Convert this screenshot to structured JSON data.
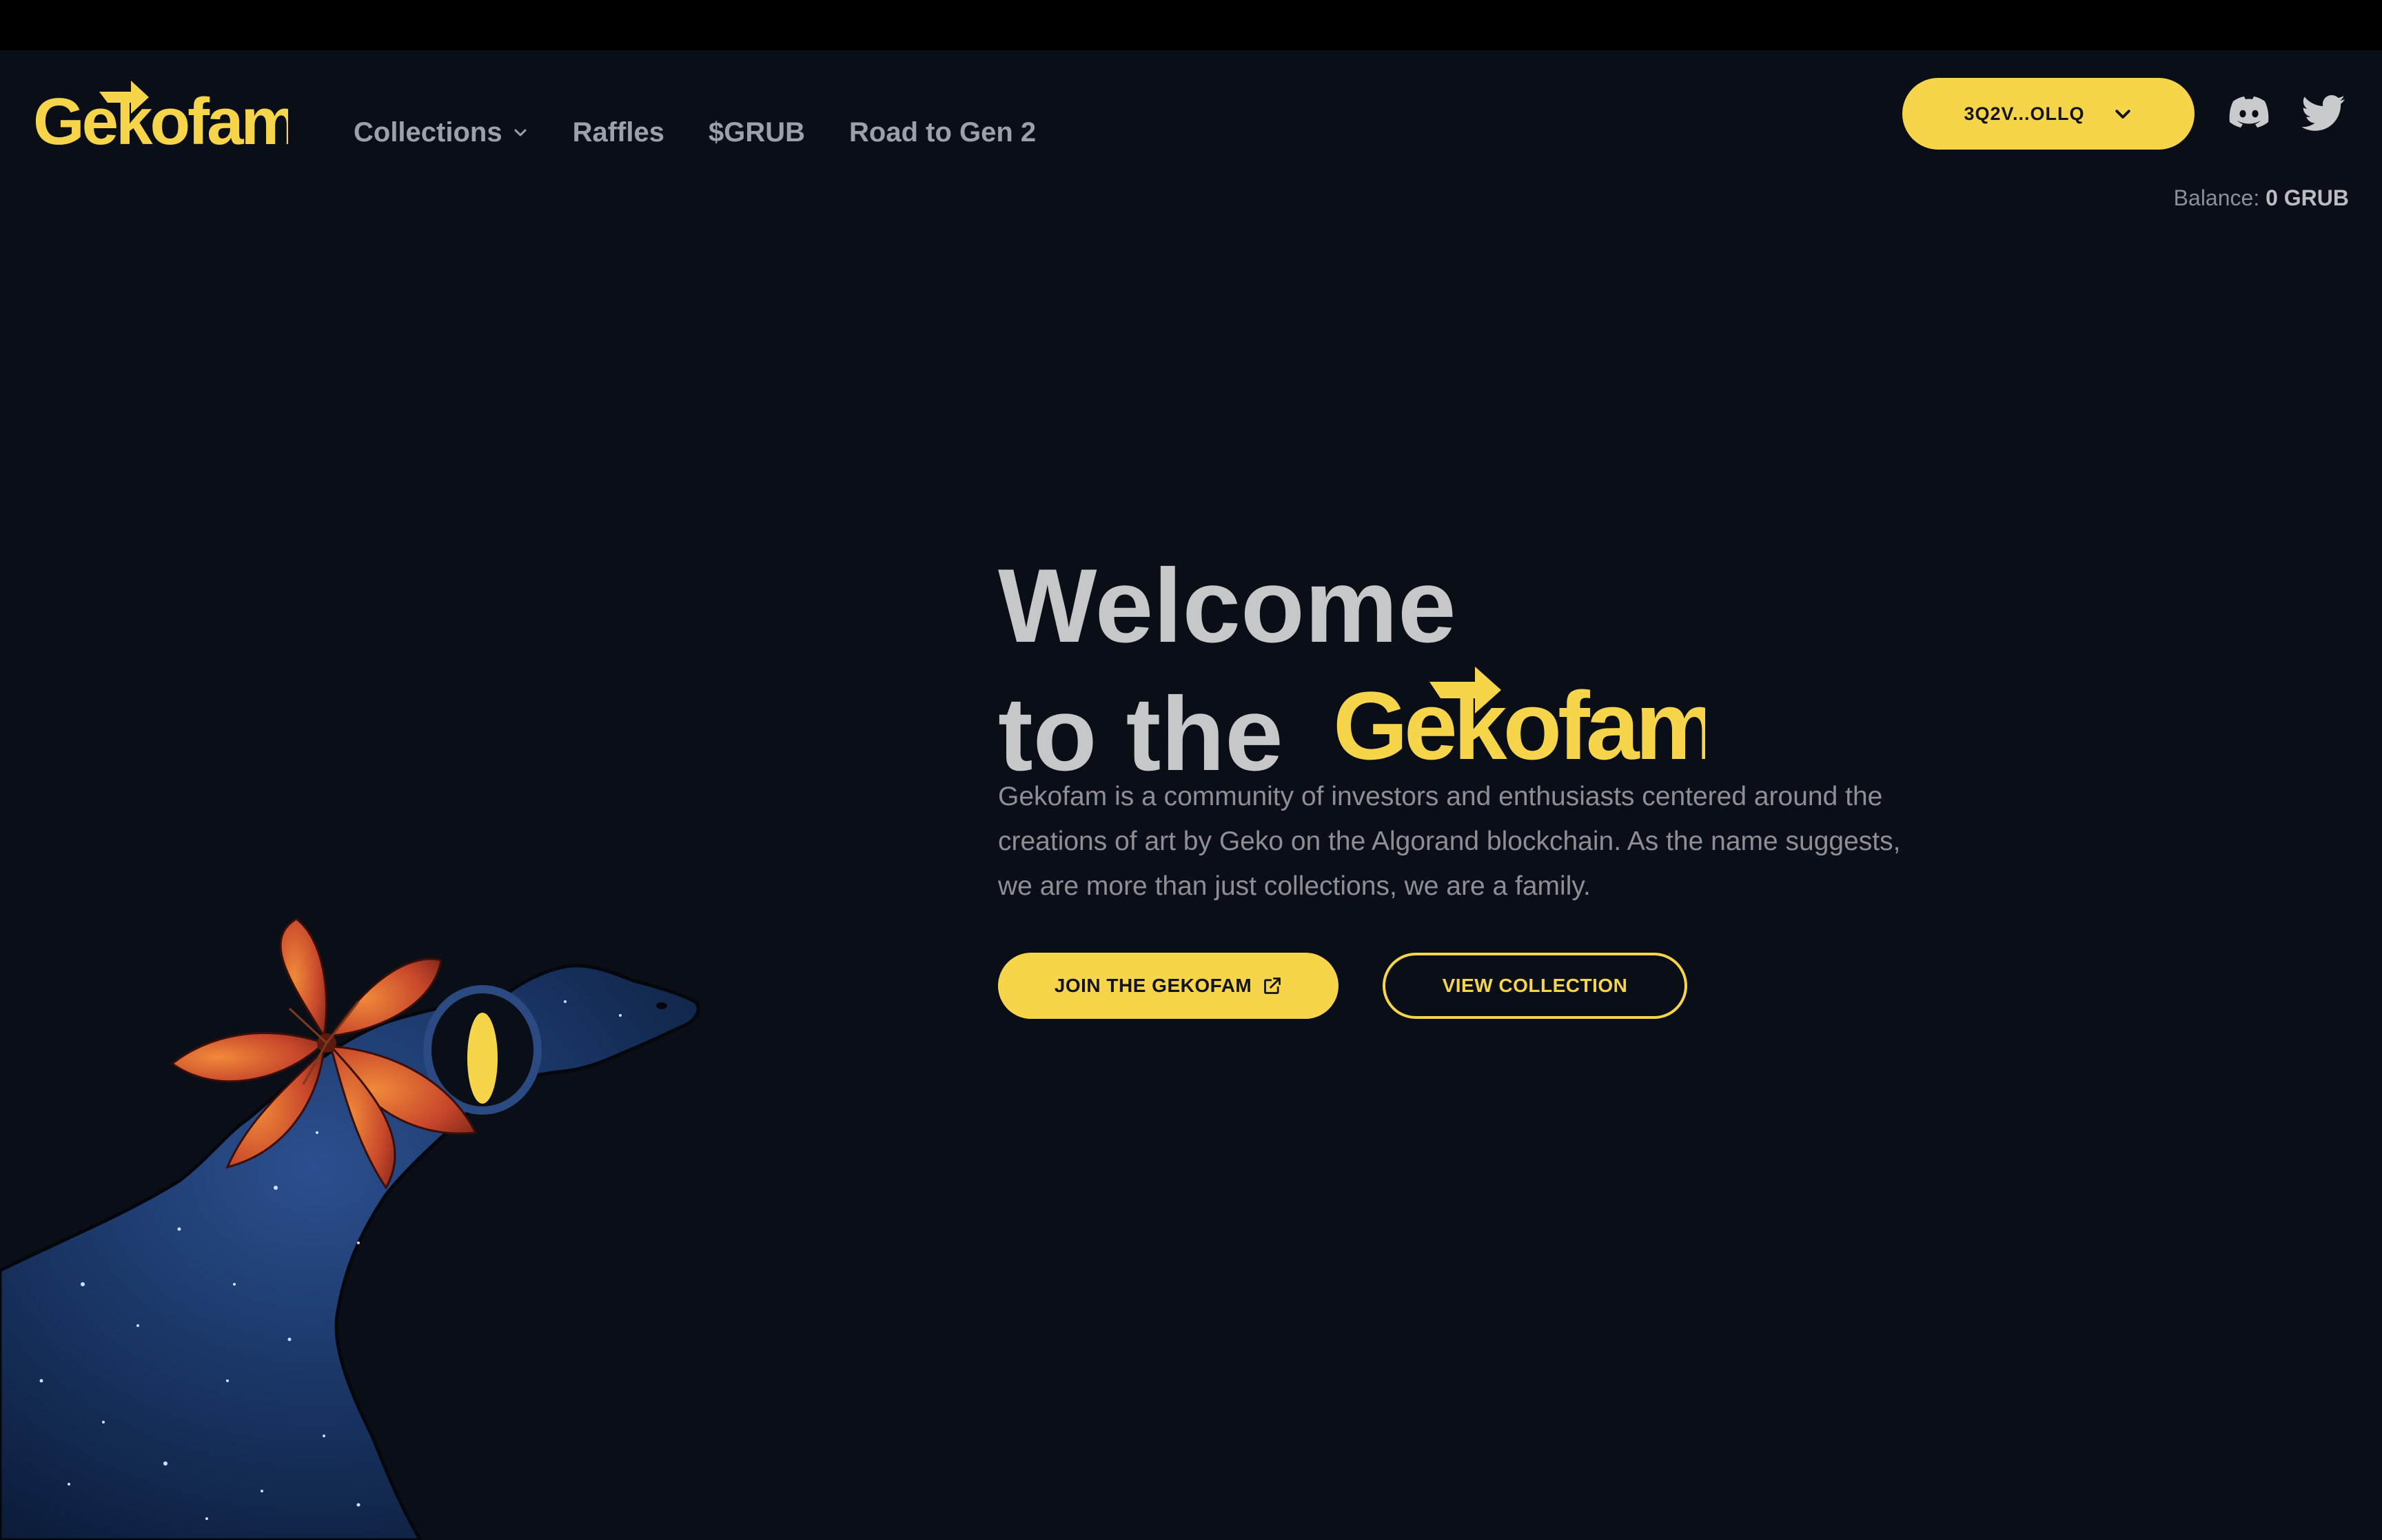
{
  "brand": {
    "name": "Gekofam",
    "accent": "#f7d54a",
    "background": "#0a0e16"
  },
  "nav": {
    "items": [
      {
        "label": "Collections",
        "has_dropdown": true
      },
      {
        "label": "Raffles"
      },
      {
        "label": "$GRUB"
      },
      {
        "label": "Road to Gen 2"
      }
    ]
  },
  "wallet": {
    "address": "3Q2V...OLLQ",
    "icon": "chevron-down-icon"
  },
  "social": [
    {
      "icon": "discord-icon"
    },
    {
      "icon": "twitter-icon"
    }
  ],
  "balance": {
    "label": "Balance:",
    "value": "0 GRUB"
  },
  "hero": {
    "title_line1": "Welcome",
    "title_line2": "to the",
    "description": "Gekofam is a community of investors and enthusiasts centered around the creations of art by Geko on the Algorand blockchain. As the name suggests, we are more than just collections, we are a family.",
    "primary_button": "JOIN THE GEKOFAM",
    "secondary_button": "VIEW COLLECTION"
  }
}
